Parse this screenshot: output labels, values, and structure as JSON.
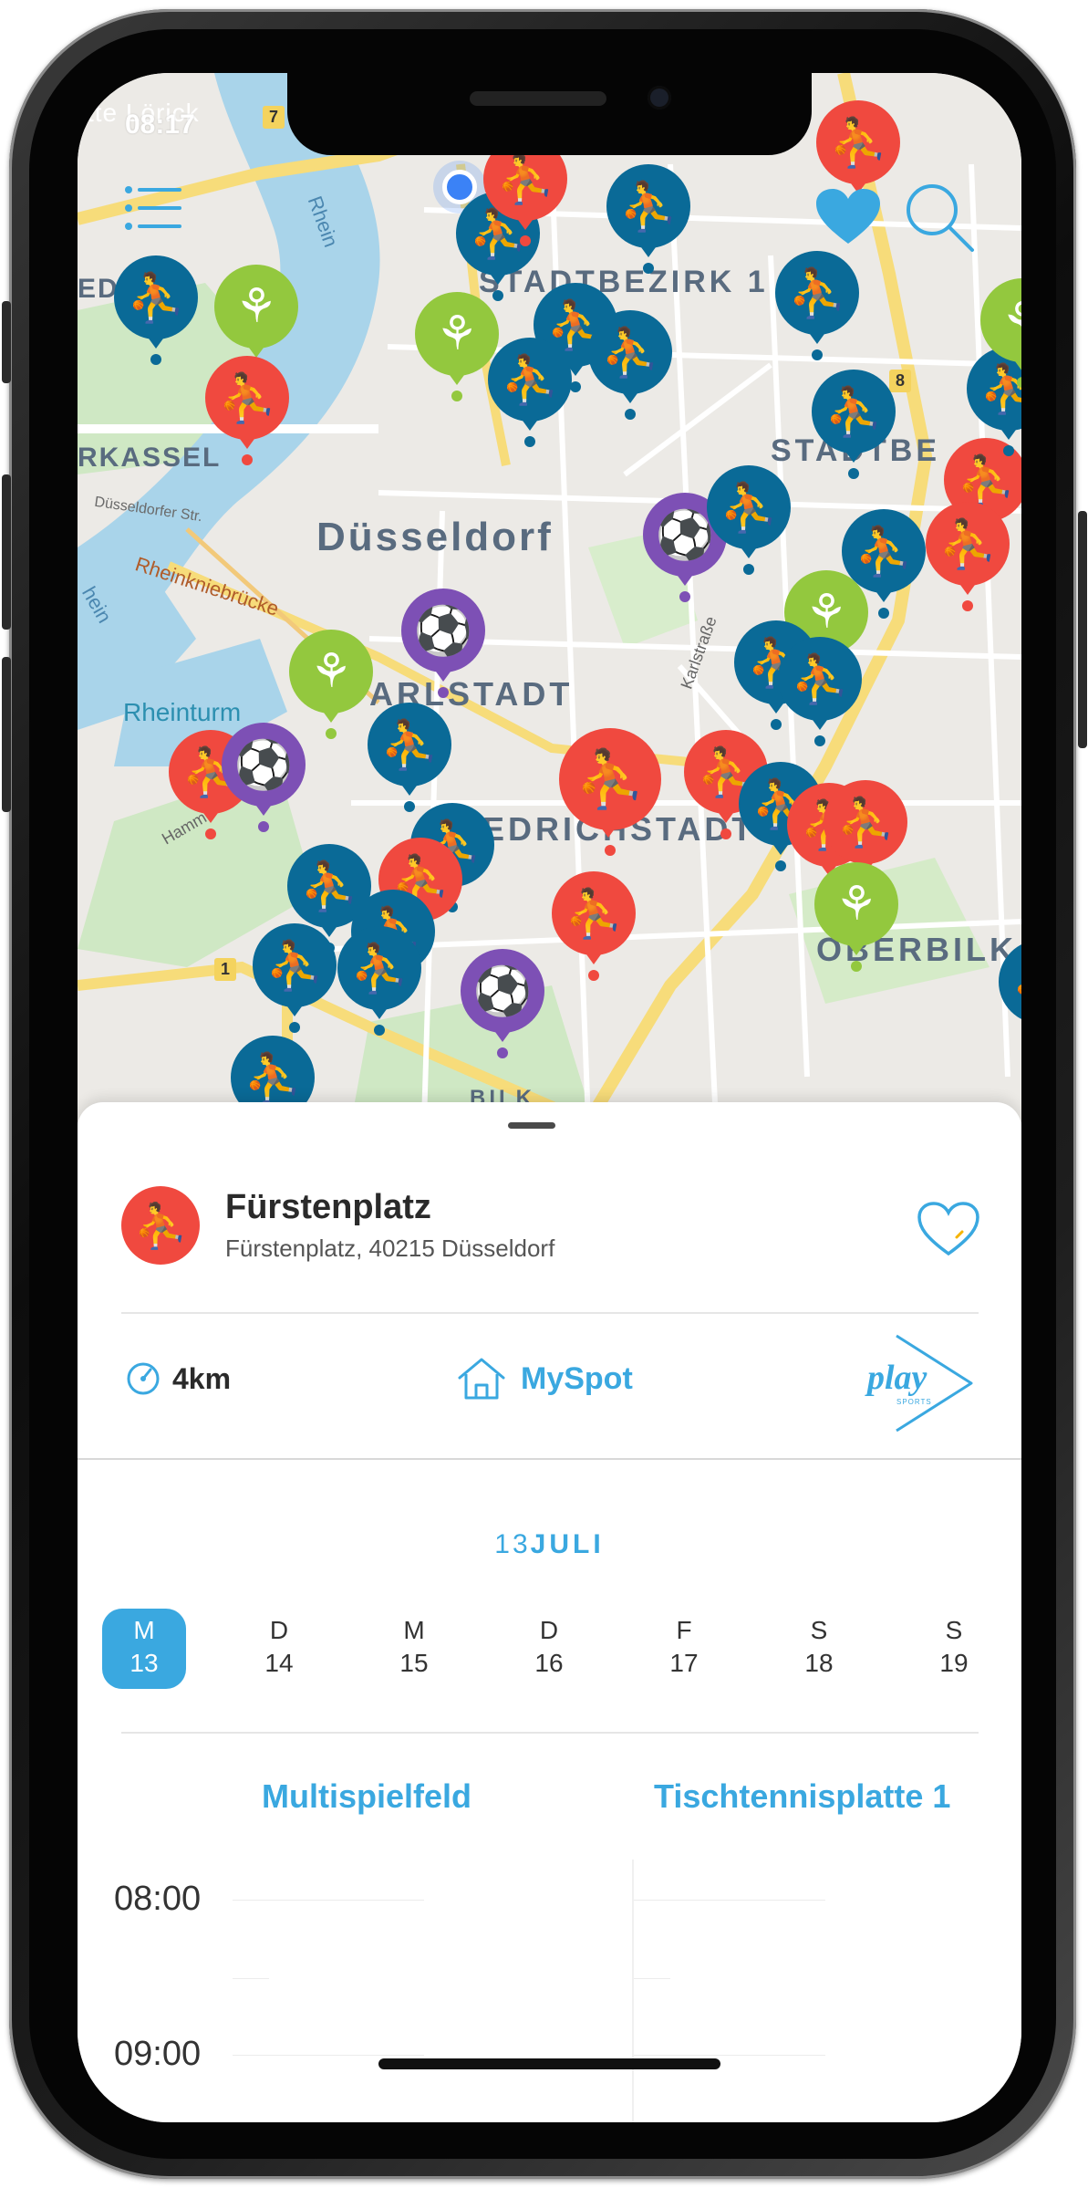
{
  "status_bar": {
    "time": "08:17"
  },
  "map": {
    "labels": {
      "loerick": "tte Lörick",
      "stadtbezirk_1": "STADTBEZIRK 1",
      "stadtbezirk_2": "STADTBE",
      "kassel": "RKASSEL",
      "duesseldorf": "Düsseldorf",
      "rheinkniebruecke": "Rheinkniebrücke",
      "duesseldorfer_str": "Düsseldorfer Str.",
      "rhein": "Rhein",
      "rhein_2": "hein",
      "rheinturm": "Rheinturm",
      "karlstadt": "ARLSTADT",
      "friedrichstadt": "IEDRICHSTADT",
      "oberbilk": "OBERBILK",
      "bilk": "BILK",
      "karlstrasse": "Karlstraße",
      "hamm": "Hamme",
      "ede": "EDE",
      "road_7": "7",
      "road_8": "8",
      "road_1": "1"
    },
    "pins": [
      {
        "type": "blue",
        "icon": "table-tennis"
      },
      {
        "type": "red",
        "icon": "basketball"
      },
      {
        "type": "green",
        "icon": "fitness"
      },
      {
        "type": "purple",
        "icon": "football"
      }
    ]
  },
  "spot": {
    "name": "Fürstenplatz",
    "address": "Fürstenplatz, 40215 Düsseldorf",
    "distance": "4km",
    "myspot_label": "MySpot",
    "play_logo_text": "play",
    "play_logo_sub": "SPORTS"
  },
  "calendar": {
    "day_num": "13",
    "month": "JULI",
    "days": [
      {
        "letter": "M",
        "num": "13",
        "selected": true
      },
      {
        "letter": "D",
        "num": "14"
      },
      {
        "letter": "M",
        "num": "15"
      },
      {
        "letter": "D",
        "num": "16"
      },
      {
        "letter": "F",
        "num": "17"
      },
      {
        "letter": "S",
        "num": "18"
      },
      {
        "letter": "S",
        "num": "19"
      }
    ]
  },
  "courts": [
    "Multispielfeld",
    "Tischtennisplatte 1"
  ],
  "times": [
    "08:00",
    "09:00"
  ],
  "colors": {
    "accent": "#3aa8e0",
    "pin_blue": "#0a6a97",
    "pin_red": "#f0493f",
    "pin_green": "#93c83e",
    "pin_purple": "#7d50b5"
  }
}
